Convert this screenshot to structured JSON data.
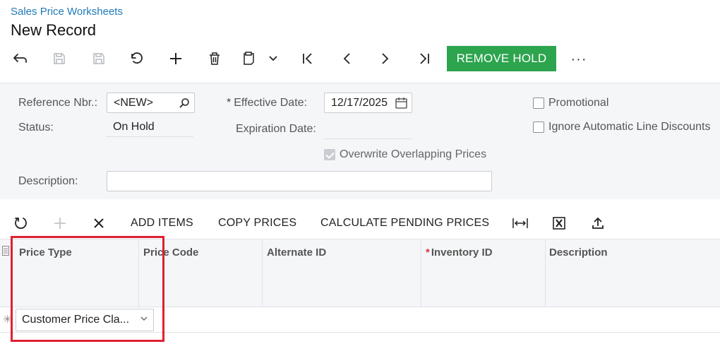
{
  "header": {
    "breadcrumb": "Sales Price Worksheets",
    "title": "New Record"
  },
  "toolbar": {
    "remove_hold_label": "REMOVE HOLD",
    "more_label": "···",
    "accent_color": "#2da44e"
  },
  "form": {
    "reference_nbr_label": "Reference Nbr.:",
    "reference_nbr_value": "<NEW>",
    "status_label": "Status:",
    "status_value": "On Hold",
    "effective_date_label": "Effective Date:",
    "effective_date_value": "12/17/2025",
    "expiration_date_label": "Expiration Date:",
    "overwrite_label": "Overwrite Overlapping Prices",
    "promotional_label": "Promotional",
    "ignore_discounts_label": "Ignore Automatic Line Discounts",
    "description_label": "Description:",
    "description_value": "",
    "required_marker": "*"
  },
  "grid_toolbar": {
    "add_items": "ADD ITEMS",
    "copy_prices": "COPY PRICES",
    "calculate_pending": "CALCULATE PENDING PRICES"
  },
  "grid": {
    "columns": [
      "Price Type",
      "Price Code",
      "Alternate ID",
      "Inventory ID",
      "Description"
    ],
    "required_marker": "*",
    "new_row_marker": "✳",
    "price_type_value": "Customer Price Cla..."
  },
  "colors": {
    "link": "#1f7ab8",
    "highlight": "#e02030",
    "required": "#d9363e"
  }
}
